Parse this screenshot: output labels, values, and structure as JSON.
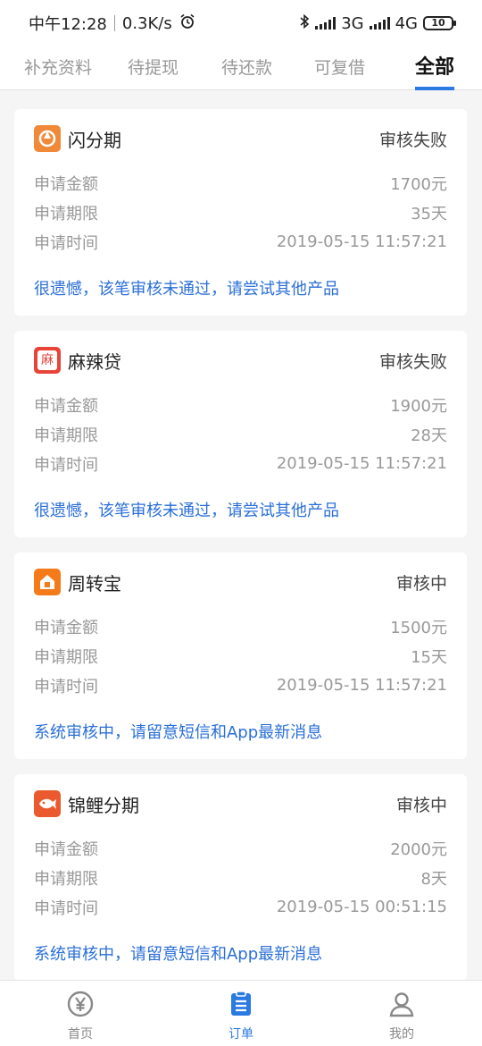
{
  "status_bar": {
    "time": "中午12:28",
    "speed": "0.3K/s",
    "net1": "3G",
    "net2": "4G",
    "battery": "10"
  },
  "tabs": [
    {
      "label": "补充资料",
      "active": false
    },
    {
      "label": "待提现",
      "active": false
    },
    {
      "label": "待还款",
      "active": false
    },
    {
      "label": "可复借",
      "active": false
    },
    {
      "label": "全部",
      "active": true
    }
  ],
  "field_labels": {
    "amount": "申请金额",
    "term": "申请期限",
    "time": "申请时间"
  },
  "orders": [
    {
      "name": "闪分期",
      "status": "审核失败",
      "amount": "1700元",
      "term": "35天",
      "time": "2019-05-15 11:57:21",
      "tip": "很遗憾，该笔审核未通过，请尝试其他产品",
      "logo_color": "#f08a3a",
      "logo_icon": "swirl-logo-icon"
    },
    {
      "name": "麻辣贷",
      "status": "审核失败",
      "amount": "1900元",
      "term": "28天",
      "time": "2019-05-15 11:57:21",
      "tip": "很遗憾，该笔审核未通过，请尝试其他产品",
      "logo_color": "#e8443a",
      "logo_icon": "ma-logo-icon",
      "logo_text": "麻"
    },
    {
      "name": "周转宝",
      "status": "审核中",
      "amount": "1500元",
      "term": "15天",
      "time": "2019-05-15 11:57:21",
      "tip": "系统审核中，请留意短信和App最新消息",
      "logo_color": "#f47a1a",
      "logo_icon": "house-logo-icon"
    },
    {
      "name": "锦鲤分期",
      "status": "审核中",
      "amount": "2000元",
      "term": "8天",
      "time": "2019-05-15 00:51:15",
      "tip": "系统审核中，请留意短信和App最新消息",
      "logo_color": "#ea5a2e",
      "logo_icon": "koi-logo-icon"
    }
  ],
  "bottom_nav": [
    {
      "label": "首页",
      "icon": "yen-icon",
      "active": false
    },
    {
      "label": "订单",
      "icon": "order-list-icon",
      "active": true
    },
    {
      "label": "我的",
      "icon": "user-icon",
      "active": false
    }
  ],
  "colors": {
    "accent": "#2a7ae2",
    "tip_text": "#2a6fd8"
  }
}
